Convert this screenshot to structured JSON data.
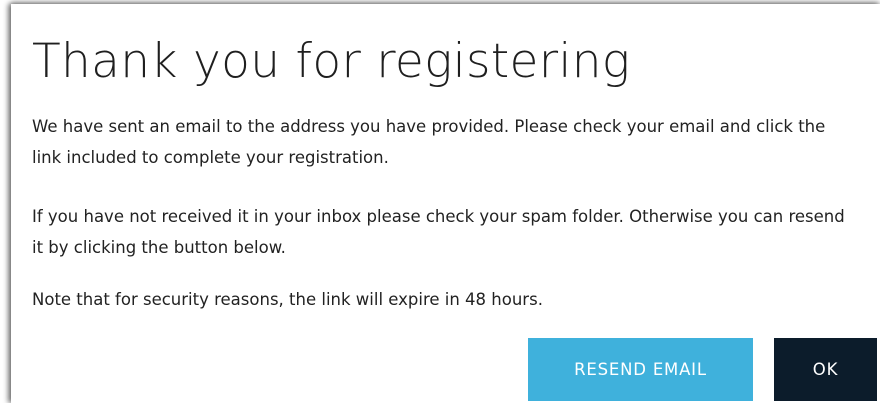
{
  "dialog": {
    "title": "Thank you for registering",
    "paragraphs": [
      "We have sent an email to the address you have provided. Please check your email and click the link included to complete your registration.",
      "If you have not received it in your inbox please check your spam folder. Otherwise you can resend it by clicking the button below.",
      "Note that for security reasons, the link will expire in 48 hours."
    ],
    "buttons": {
      "resend_label": "RESEND EMAIL",
      "ok_label": "OK"
    }
  },
  "colors": {
    "resend_button": "#3fb1dc",
    "ok_button": "#0c1c2b",
    "text": "#222222",
    "background": "#ffffff"
  }
}
